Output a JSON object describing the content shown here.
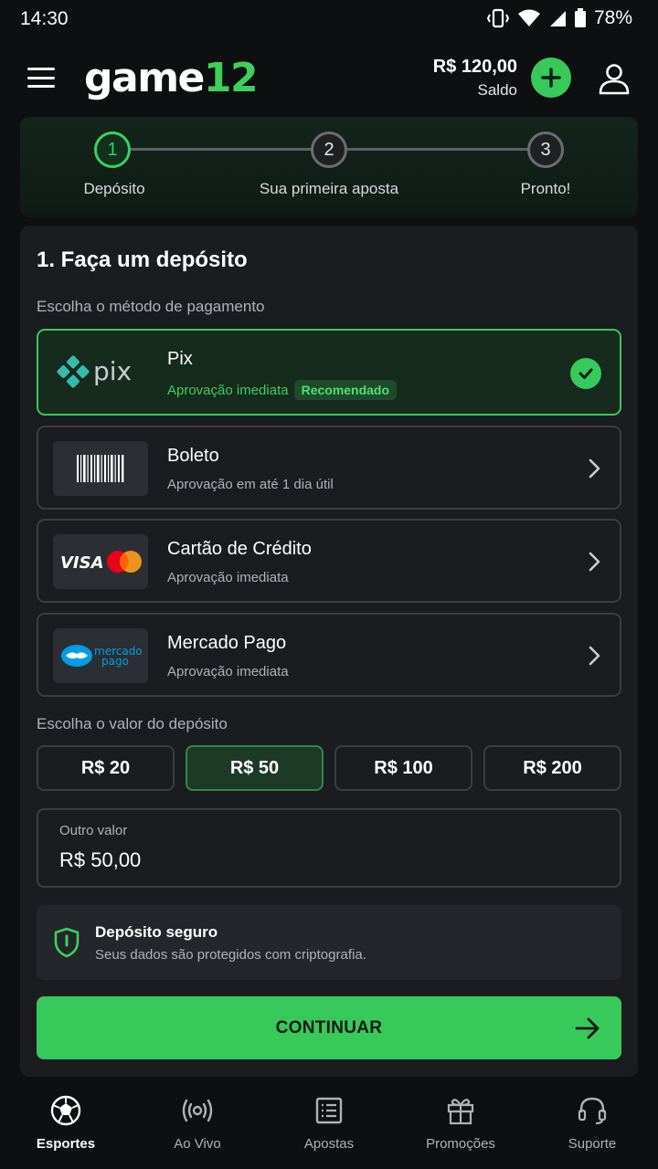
{
  "status_bar": {
    "time": "14:30",
    "battery_pct": "78%"
  },
  "header": {
    "logo_word": "game",
    "logo_num": "12",
    "balance_amount": "R$ 120,00",
    "balance_label": "Saldo"
  },
  "stepper": {
    "steps": [
      {
        "number": "1",
        "label": "Depósito",
        "active": true
      },
      {
        "number": "2",
        "label": "Sua primeira aposta",
        "active": false
      },
      {
        "number": "3",
        "label": "Pronto!",
        "active": false
      }
    ]
  },
  "deposit": {
    "heading": "1. Faça um depósito",
    "method_label": "Escolha o método de pagamento",
    "methods": [
      {
        "name": "Pix",
        "desc": "Aprovação imediata",
        "badge": "Recomendado",
        "logo_text": "pix",
        "selected": true
      },
      {
        "name": "Boleto",
        "desc": "Aprovação em até 1 dia útil",
        "selected": false
      },
      {
        "name": "Cartão de Crédito",
        "desc": "Aprovação imediata",
        "logo_text": "VISA",
        "selected": false
      },
      {
        "name": "Mercado Pago",
        "desc": "Aprovação imediata",
        "logo_text_1": "mercado",
        "logo_text_2": "pago",
        "selected": false
      }
    ],
    "amount_label": "Escolha o valor do depósito",
    "amounts": [
      "R$ 20",
      "R$ 50",
      "R$ 100",
      "R$ 200"
    ],
    "selected_amount": "R$ 50",
    "other_label": "Outro valor",
    "other_value": "R$ 50,00",
    "secure_title": "Depósito seguro",
    "secure_sub": "Seus dados são protegidos com criptografia.",
    "continue_label": "CONTINUAR"
  },
  "bottom_nav": [
    {
      "label": "Esportes",
      "icon": "soccer-ball-icon",
      "active": true
    },
    {
      "label": "Ao Vivo",
      "icon": "broadcast-icon",
      "active": false
    },
    {
      "label": "Apostas",
      "icon": "receipt-icon",
      "active": false
    },
    {
      "label": "Promoções",
      "icon": "gift-icon",
      "active": false
    },
    {
      "label": "Suporte",
      "icon": "headset-icon",
      "active": false
    }
  ],
  "colors": {
    "accent": "#37c95a",
    "background": "#0d0f10",
    "card": "#1a1c1f"
  }
}
